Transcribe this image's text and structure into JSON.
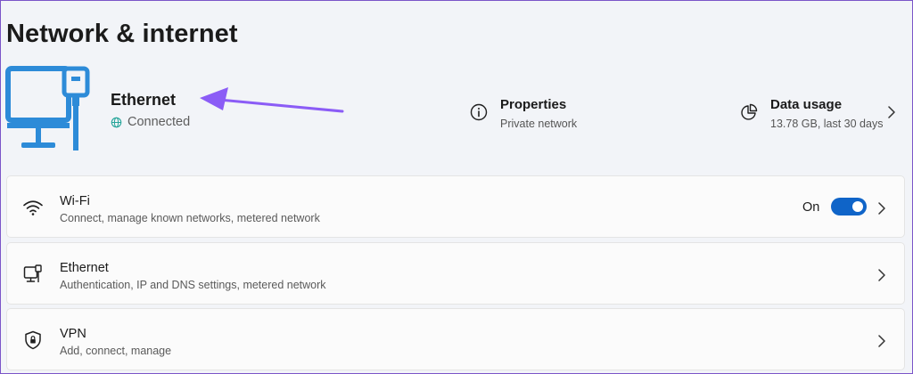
{
  "page": {
    "title": "Network & internet"
  },
  "hero": {
    "name": "Ethernet",
    "status": "Connected",
    "properties": {
      "title": "Properties",
      "subtitle": "Private network"
    },
    "data_usage": {
      "title": "Data usage",
      "subtitle": "13.78 GB, last 30 days"
    }
  },
  "cards": {
    "wifi": {
      "title": "Wi-Fi",
      "subtitle": "Connect, manage known networks, metered network",
      "toggle_label": "On",
      "toggle_on": true
    },
    "ethernet": {
      "title": "Ethernet",
      "subtitle": "Authentication, IP and DNS settings, metered network"
    },
    "vpn": {
      "title": "VPN",
      "subtitle": "Add, connect, manage"
    }
  },
  "colors": {
    "accent": "#0f64c8",
    "icon_blue": "#2d8bd8",
    "annotation_arrow": "#8b5cf6",
    "frame": "#7b55c9"
  },
  "icons": [
    "monitor-ethernet-icon",
    "globe-icon",
    "info-icon",
    "pie-chart-icon",
    "chevron-right-icon",
    "wifi-icon",
    "ethernet-icon",
    "shield-icon"
  ]
}
